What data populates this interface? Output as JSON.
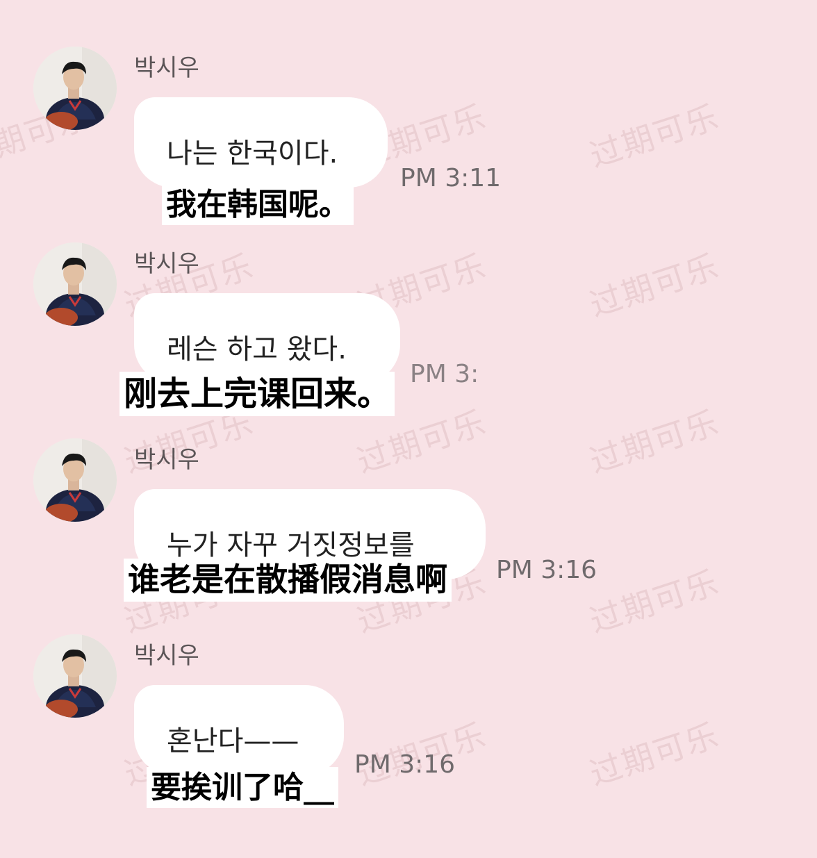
{
  "watermark_text": "过期可乐",
  "messages": [
    {
      "sender": "박시우",
      "text": "나는 한국이다.",
      "subtitle": "我在韩国呢。",
      "time": "PM 3:11"
    },
    {
      "sender": "박시우",
      "text": "레슨 하고 왔다.",
      "subtitle": "刚去上完课回来。",
      "time": "PM 3:"
    },
    {
      "sender": "박시우",
      "text": "누가 자꾸 거짓정보를",
      "subtitle": "谁老是在散播假消息啊",
      "time": "PM 3:16"
    },
    {
      "sender": "박시우",
      "text": "혼난다——",
      "subtitle": "要挨训了哈__",
      "time": "PM 3:16"
    }
  ]
}
